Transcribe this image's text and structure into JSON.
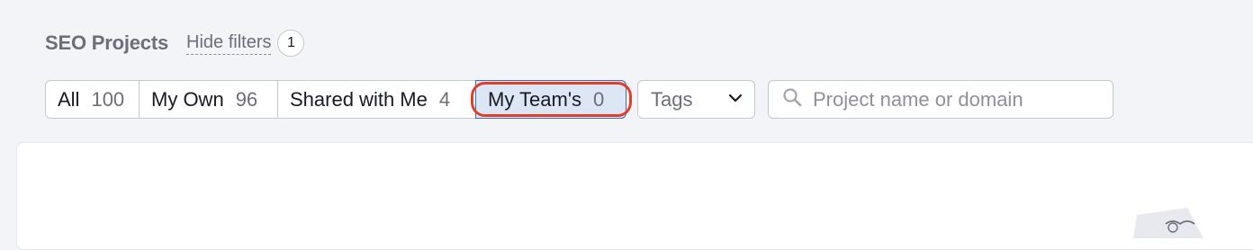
{
  "header": {
    "title": "SEO Projects",
    "hide_filters_label": "Hide filters",
    "active_filter_count": "1"
  },
  "filters": {
    "segments": [
      {
        "label": "All",
        "count": "100",
        "selected": false
      },
      {
        "label": "My Own",
        "count": "96",
        "selected": false
      },
      {
        "label": "Shared with Me",
        "count": "4",
        "selected": false
      },
      {
        "label": "My Team's",
        "count": "0",
        "selected": true
      }
    ],
    "tags_select": {
      "value": "Tags",
      "icon": "chevron-down-icon"
    },
    "search": {
      "placeholder": "Project name or domain",
      "value": "",
      "icon": "search-icon"
    }
  },
  "colors": {
    "background": "#f3f4f8",
    "selected_segment": "#dde6f5",
    "selected_border": "#3d6fbf",
    "highlight_ring": "#e0402a"
  }
}
